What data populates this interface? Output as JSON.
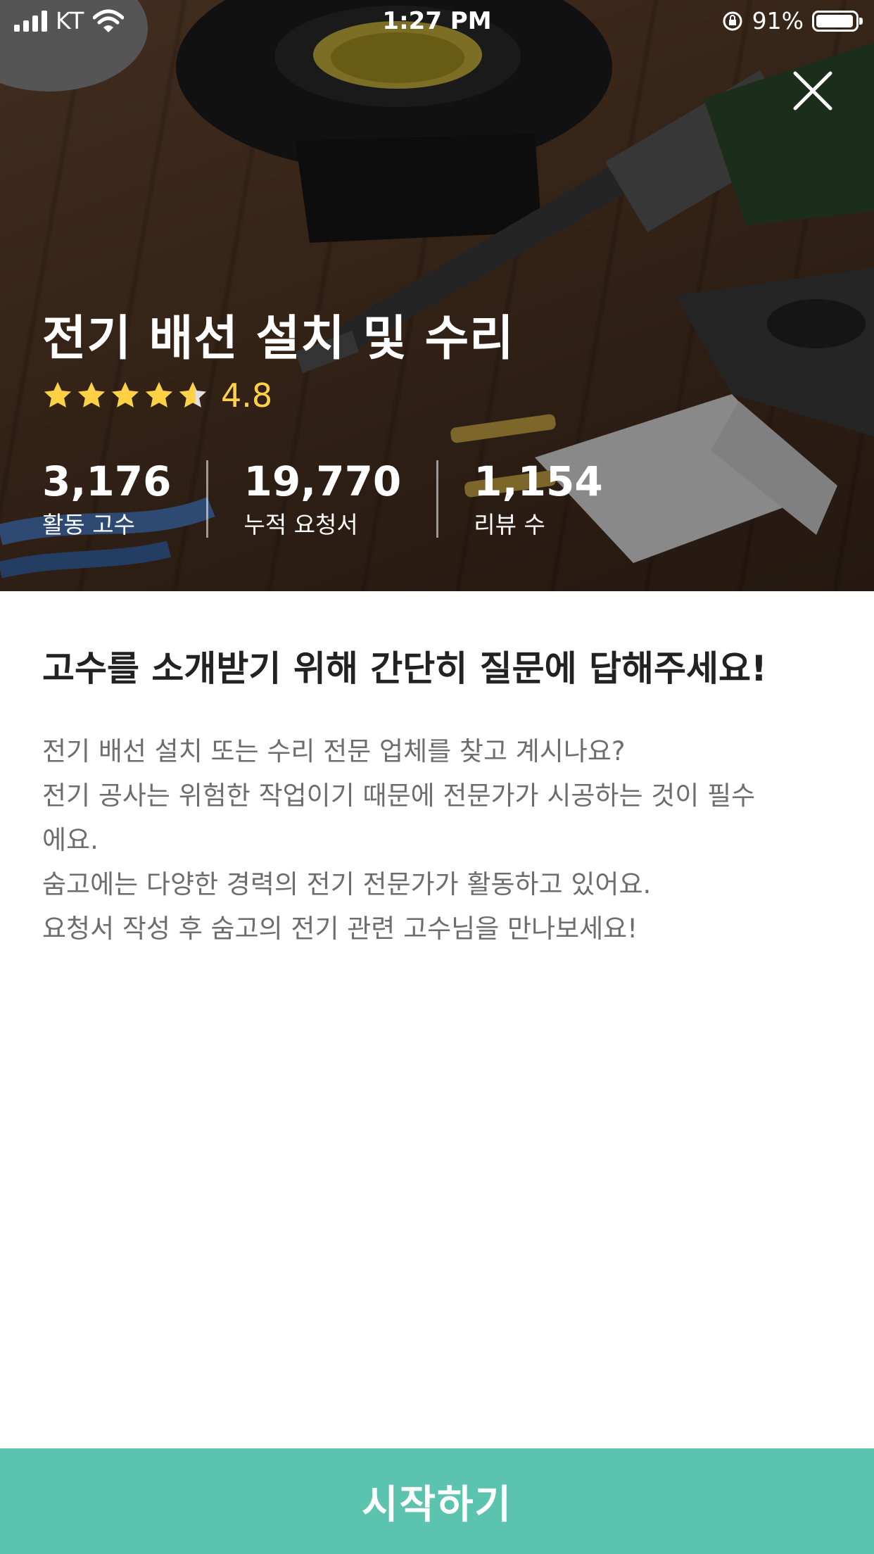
{
  "status_bar": {
    "carrier": "KT",
    "time": "1:27 PM",
    "battery": "91%",
    "icons": [
      "signal-icon",
      "wifi-icon",
      "orientation-lock-icon",
      "battery-icon"
    ]
  },
  "hero": {
    "close_icon": "close-icon",
    "title": "전기 배선 설치 및 수리",
    "rating": {
      "value": "4.8",
      "stars": 4.8,
      "star_color": "#ffd147",
      "empty_star_color": "#e0e0e0"
    },
    "stats": [
      {
        "value": "3,176",
        "label": "활동 고수"
      },
      {
        "value": "19,770",
        "label": "누적 요청서"
      },
      {
        "value": "1,154",
        "label": "리뷰 수"
      }
    ]
  },
  "intro": {
    "heading": "고수를 소개받기 위해 간단히 질문에 답해주세요!",
    "lines": [
      "전기 배선 설치 또는 수리 전문 업체를 찾고 계시나요?",
      "전기 공사는 위험한 작업이기 때문에 전문가가 시공하는 것이 필수",
      "에요.",
      "숨고에는 다양한 경력의 전기 전문가가 활동하고 있어요.",
      "요청서 작성 후 숨고의 전기 관련 고수님을 만나보세요!"
    ]
  },
  "cta": {
    "label": "시작하기",
    "color": "#5cc4ae"
  }
}
